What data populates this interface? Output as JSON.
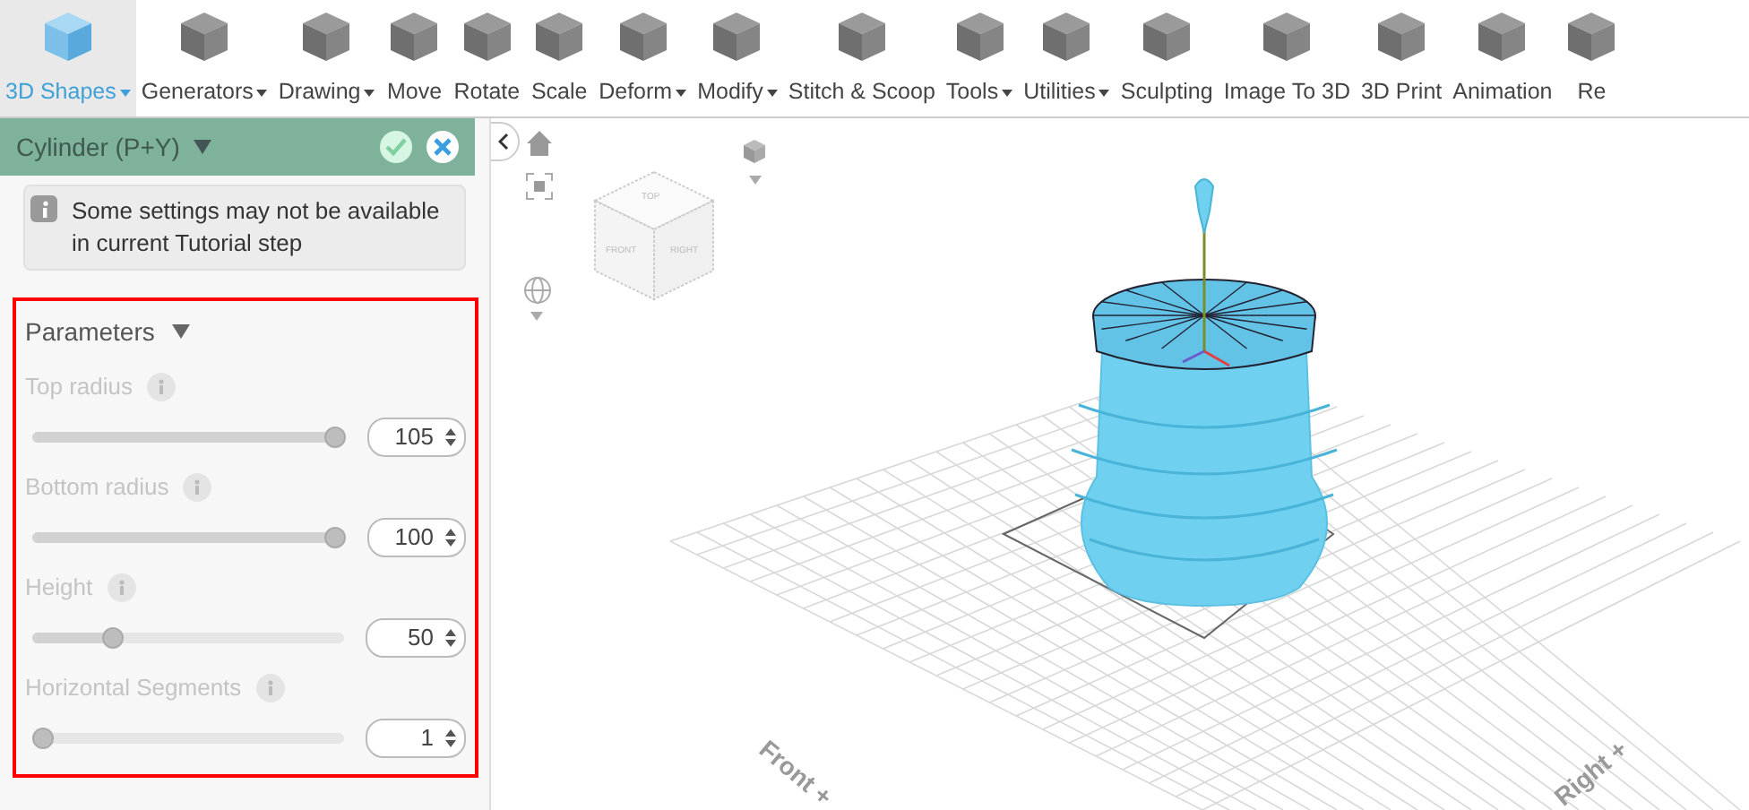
{
  "toolbar": [
    {
      "label": "3D Shapes",
      "dropdown": true,
      "selected": true
    },
    {
      "label": "Generators",
      "dropdown": true,
      "selected": false
    },
    {
      "label": "Drawing",
      "dropdown": true,
      "selected": false
    },
    {
      "label": "Move",
      "dropdown": false,
      "selected": false
    },
    {
      "label": "Rotate",
      "dropdown": false,
      "selected": false
    },
    {
      "label": "Scale",
      "dropdown": false,
      "selected": false
    },
    {
      "label": "Deform",
      "dropdown": true,
      "selected": false
    },
    {
      "label": "Modify",
      "dropdown": true,
      "selected": false
    },
    {
      "label": "Stitch & Scoop",
      "dropdown": false,
      "selected": false
    },
    {
      "label": "Tools",
      "dropdown": true,
      "selected": false
    },
    {
      "label": "Utilities",
      "dropdown": true,
      "selected": false
    },
    {
      "label": "Sculpting",
      "dropdown": false,
      "selected": false
    },
    {
      "label": "Image To 3D",
      "dropdown": false,
      "selected": false
    },
    {
      "label": "3D Print",
      "dropdown": false,
      "selected": false
    },
    {
      "label": "Animation",
      "dropdown": false,
      "selected": false
    },
    {
      "label": "Re",
      "dropdown": false,
      "selected": false
    }
  ],
  "panel": {
    "title": "Cylinder (P+Y)",
    "notice": "Some settings may not be available in current Tutorial step",
    "section": {
      "title": "Parameters",
      "expanded": true,
      "parameters": [
        {
          "label": "Top radius",
          "value": "105",
          "level": 1.0
        },
        {
          "label": "Bottom radius",
          "value": "100",
          "level": 1.0
        },
        {
          "label": "Height",
          "value": "50",
          "level": 0.24
        },
        {
          "label": "Horizontal Segments",
          "value": "1",
          "level": 0.0
        }
      ]
    }
  },
  "viewport": {
    "cube_faces": [
      "TOP",
      "FRONT",
      "RIGHT"
    ],
    "axis_labels": [
      "Front +",
      "Right +"
    ]
  }
}
